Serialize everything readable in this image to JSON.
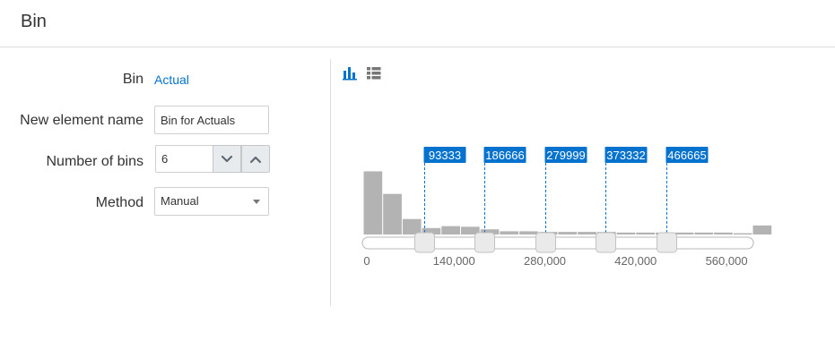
{
  "header": {
    "title": "Bin"
  },
  "form": {
    "bin_label": "Bin",
    "bin_value": "Actual",
    "name_label": "New element name",
    "name_value": "Bin for Actuals",
    "bins_label": "Number of bins",
    "bins_value": "6",
    "method_label": "Method",
    "method_value": "Manual"
  },
  "toolbar": {
    "chart_view_icon": "bar-chart-icon",
    "list_view_icon": "list-icon"
  },
  "colors": {
    "accent": "#0572ce",
    "bar": "#b3b3b3"
  },
  "chart_data": {
    "type": "bar",
    "title": "",
    "xlabel": "",
    "ylabel": "",
    "xlim": [
      0,
      600000
    ],
    "ylim": [
      0,
      100
    ],
    "bin_width": 30000,
    "values": [
      98,
      63,
      24,
      10,
      13,
      12,
      8,
      5,
      5,
      4,
      4,
      4,
      4,
      3,
      3,
      3,
      3,
      3,
      3,
      2,
      14
    ],
    "x_ticks": [
      {
        "value": 0,
        "label": "0"
      },
      {
        "value": 140000,
        "label": "140,000"
      },
      {
        "value": 280000,
        "label": "280,000"
      },
      {
        "value": 420000,
        "label": "420,000"
      },
      {
        "value": 560000,
        "label": "560,000"
      }
    ],
    "bin_boundaries": [
      {
        "value": 93333,
        "label": "93333"
      },
      {
        "value": 186666,
        "label": "186666"
      },
      {
        "value": 279999,
        "label": "279999"
      },
      {
        "value": 373332,
        "label": "373332"
      },
      {
        "value": 466665,
        "label": "466665"
      }
    ]
  }
}
